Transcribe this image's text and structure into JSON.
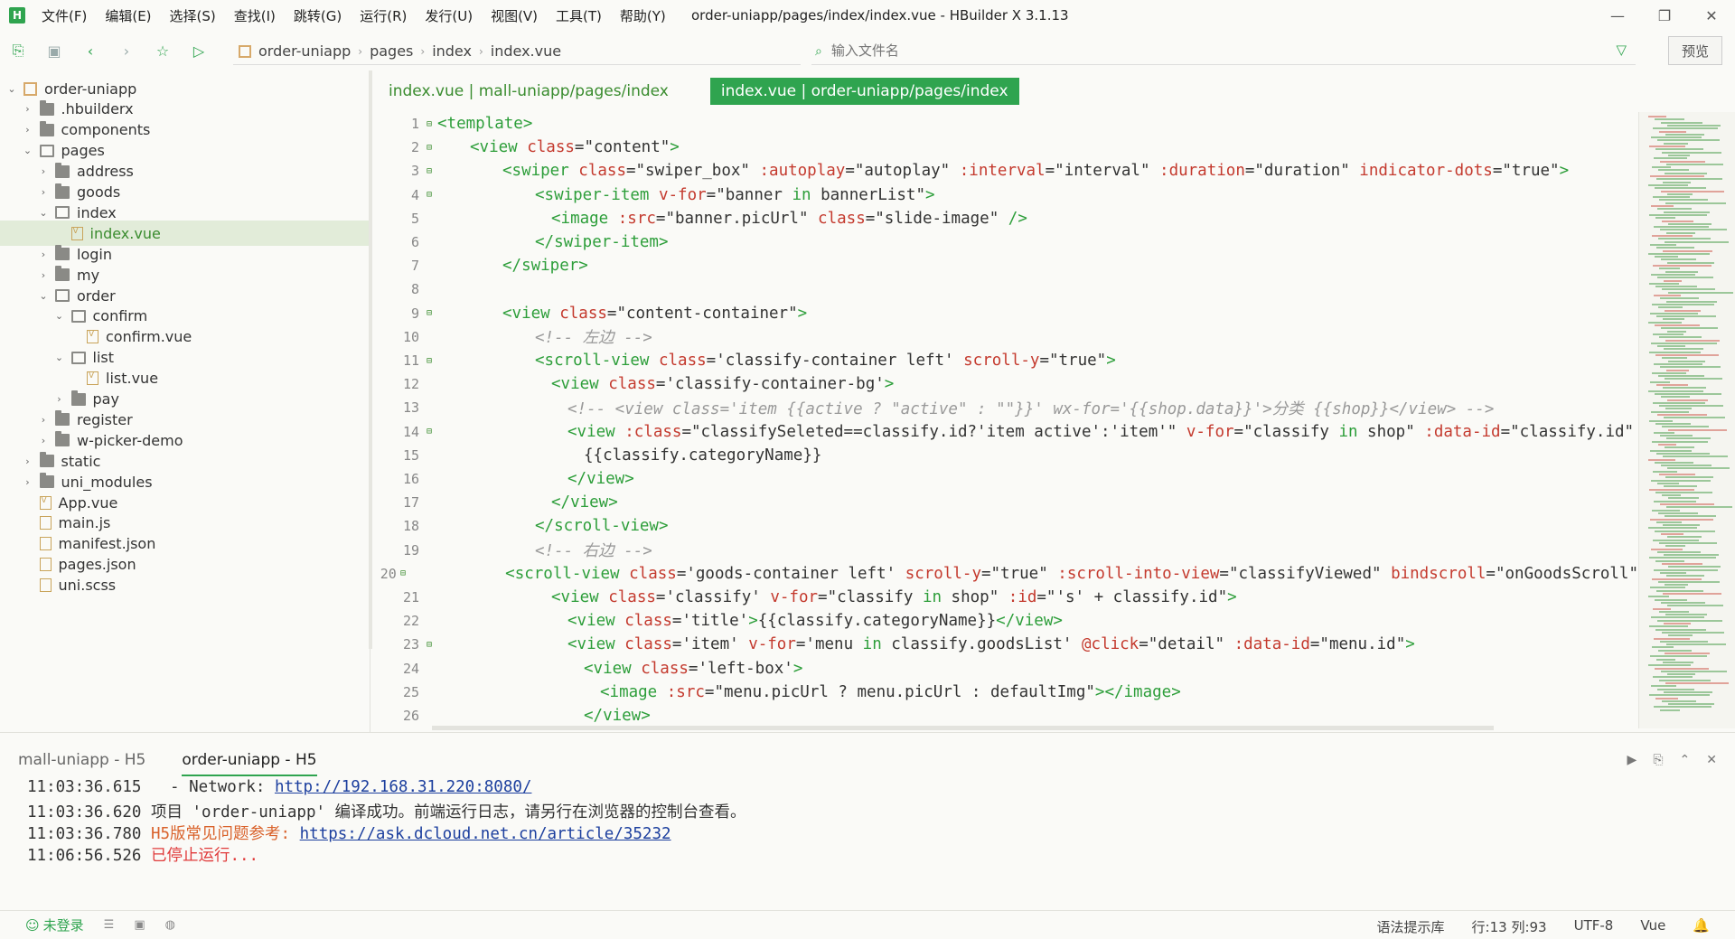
{
  "window": {
    "title": "order-uniapp/pages/index/index.vue - HBuilder X 3.1.13",
    "logo_text": "H",
    "controls": [
      "—",
      "❐",
      "✕"
    ]
  },
  "menu": [
    "文件(F)",
    "编辑(E)",
    "选择(S)",
    "查找(I)",
    "跳转(G)",
    "运行(R)",
    "发行(U)",
    "视图(V)",
    "工具(T)",
    "帮助(Y)"
  ],
  "toolbar": {
    "breadcrumb": [
      "order-uniapp",
      "pages",
      "index",
      "index.vue"
    ],
    "search_placeholder": "输入文件名",
    "preview_label": "预览"
  },
  "sidebar": {
    "items": [
      {
        "label": "order-uniapp",
        "depth": 0,
        "type": "project",
        "arrow": "⌄"
      },
      {
        "label": ".hbuilderx",
        "depth": 1,
        "type": "folder",
        "arrow": "›"
      },
      {
        "label": "components",
        "depth": 1,
        "type": "folder",
        "arrow": "›"
      },
      {
        "label": "pages",
        "depth": 1,
        "type": "folder-open",
        "arrow": "⌄"
      },
      {
        "label": "address",
        "depth": 2,
        "type": "folder",
        "arrow": "›"
      },
      {
        "label": "goods",
        "depth": 2,
        "type": "folder",
        "arrow": "›"
      },
      {
        "label": "index",
        "depth": 2,
        "type": "folder-open",
        "arrow": "⌄"
      },
      {
        "label": "index.vue",
        "depth": 3,
        "type": "vue",
        "arrow": "",
        "selected": true
      },
      {
        "label": "login",
        "depth": 2,
        "type": "folder",
        "arrow": "›"
      },
      {
        "label": "my",
        "depth": 2,
        "type": "folder",
        "arrow": "›"
      },
      {
        "label": "order",
        "depth": 2,
        "type": "folder-open",
        "arrow": "⌄"
      },
      {
        "label": "confirm",
        "depth": 3,
        "type": "folder-open",
        "arrow": "⌄"
      },
      {
        "label": "confirm.vue",
        "depth": 4,
        "type": "vue",
        "arrow": ""
      },
      {
        "label": "list",
        "depth": 3,
        "type": "folder-open",
        "arrow": "⌄"
      },
      {
        "label": "list.vue",
        "depth": 4,
        "type": "vue",
        "arrow": ""
      },
      {
        "label": "pay",
        "depth": 3,
        "type": "folder",
        "arrow": "›"
      },
      {
        "label": "register",
        "depth": 2,
        "type": "folder",
        "arrow": "›"
      },
      {
        "label": "w-picker-demo",
        "depth": 2,
        "type": "folder",
        "arrow": "›"
      },
      {
        "label": "static",
        "depth": 1,
        "type": "folder",
        "arrow": "›"
      },
      {
        "label": "uni_modules",
        "depth": 1,
        "type": "folder",
        "arrow": "›"
      },
      {
        "label": "App.vue",
        "depth": 1,
        "type": "vue",
        "arrow": ""
      },
      {
        "label": "main.js",
        "depth": 1,
        "type": "file",
        "arrow": ""
      },
      {
        "label": "manifest.json",
        "depth": 1,
        "type": "file",
        "arrow": ""
      },
      {
        "label": "pages.json",
        "depth": 1,
        "type": "file",
        "arrow": ""
      },
      {
        "label": "uni.scss",
        "depth": 1,
        "type": "file",
        "arrow": ""
      }
    ]
  },
  "editor": {
    "tabs": [
      {
        "label": "index.vue | mall-uniapp/pages/index",
        "active": false
      },
      {
        "label": "index.vue | order-uniapp/pages/index",
        "active": true
      }
    ],
    "lines": [
      {
        "n": "1",
        "fold": true,
        "indent": 0,
        "parts": [
          [
            "t-tag",
            "<template>"
          ]
        ]
      },
      {
        "n": "2",
        "fold": true,
        "indent": 2,
        "parts": [
          [
            "t-tag",
            "<view "
          ],
          [
            "t-attr",
            "class"
          ],
          [
            "t-str",
            "=\"content\""
          ],
          [
            "t-tag",
            ">"
          ]
        ]
      },
      {
        "n": "3",
        "fold": true,
        "indent": 4,
        "parts": [
          [
            "t-tag",
            "<swiper "
          ],
          [
            "t-attr",
            "class"
          ],
          [
            "t-str",
            "=\"swiper_box\" "
          ],
          [
            "t-attr",
            ":autoplay"
          ],
          [
            "t-str",
            "=\"autoplay\" "
          ],
          [
            "t-attr",
            ":interval"
          ],
          [
            "t-str",
            "=\"interval\" "
          ],
          [
            "t-attr",
            ":duration"
          ],
          [
            "t-str",
            "=\"duration\" "
          ],
          [
            "t-attr",
            "indicator-dots"
          ],
          [
            "t-str",
            "=\"true\""
          ],
          [
            "t-tag",
            ">"
          ]
        ]
      },
      {
        "n": "4",
        "fold": true,
        "indent": 6,
        "parts": [
          [
            "t-tag",
            "<swiper-item "
          ],
          [
            "t-attr",
            "v-for"
          ],
          [
            "t-str",
            "=\"banner "
          ],
          [
            "t-kw",
            "in"
          ],
          [
            "t-str",
            " bannerList\""
          ],
          [
            "t-tag",
            ">"
          ]
        ]
      },
      {
        "n": "5",
        "fold": false,
        "indent": 7,
        "parts": [
          [
            "t-tag",
            "<image "
          ],
          [
            "t-attr",
            ":src"
          ],
          [
            "t-str",
            "=\"banner.picUrl\" "
          ],
          [
            "t-attr",
            "class"
          ],
          [
            "t-str",
            "=\"slide-image\" "
          ],
          [
            "t-tag",
            "/>"
          ]
        ]
      },
      {
        "n": "6",
        "fold": false,
        "indent": 6,
        "parts": [
          [
            "t-tag",
            "</swiper-item>"
          ]
        ]
      },
      {
        "n": "7",
        "fold": false,
        "indent": 4,
        "parts": [
          [
            "t-tag",
            "</swiper>"
          ]
        ]
      },
      {
        "n": "8",
        "fold": false,
        "indent": 0,
        "parts": []
      },
      {
        "n": "9",
        "fold": true,
        "indent": 4,
        "parts": [
          [
            "t-tag",
            "<view "
          ],
          [
            "t-attr",
            "class"
          ],
          [
            "t-str",
            "=\"content-container\""
          ],
          [
            "t-tag",
            ">"
          ]
        ]
      },
      {
        "n": "10",
        "fold": false,
        "indent": 6,
        "parts": [
          [
            "t-cm",
            "<!-- 左边 -->"
          ]
        ]
      },
      {
        "n": "11",
        "fold": true,
        "indent": 6,
        "parts": [
          [
            "t-tag",
            "<scroll-view "
          ],
          [
            "t-attr",
            "class"
          ],
          [
            "t-str",
            "='classify-container left' "
          ],
          [
            "t-attr",
            "scroll-y"
          ],
          [
            "t-str",
            "=\"true\""
          ],
          [
            "t-tag",
            ">"
          ]
        ]
      },
      {
        "n": "12",
        "fold": false,
        "indent": 7,
        "parts": [
          [
            "t-tag",
            "<view "
          ],
          [
            "t-attr",
            "class"
          ],
          [
            "t-str",
            "='classify-container-bg'"
          ],
          [
            "t-tag",
            ">"
          ]
        ]
      },
      {
        "n": "13",
        "fold": false,
        "indent": 8,
        "parts": [
          [
            "t-cm",
            "<!-- <view class='item {{active ? \"active\" : \"\"}}' wx-for='{{shop.data}}'>分类 {{shop}}</view> -->"
          ]
        ]
      },
      {
        "n": "14",
        "fold": true,
        "indent": 8,
        "parts": [
          [
            "t-tag",
            "<view "
          ],
          [
            "t-attr",
            ":class"
          ],
          [
            "t-str",
            "=\"classifySeleted==classify.id?'item active':'item'\" "
          ],
          [
            "t-attr",
            "v-for"
          ],
          [
            "t-str",
            "=\"classify "
          ],
          [
            "t-kw",
            "in"
          ],
          [
            "t-str",
            " shop\" "
          ],
          [
            "t-attr",
            ":data-id"
          ],
          [
            "t-str",
            "=\"classify.id\""
          ]
        ]
      },
      {
        "n": "15",
        "fold": false,
        "indent": 9,
        "parts": [
          [
            "t-str",
            "{{classify.categoryName}}"
          ]
        ]
      },
      {
        "n": "16",
        "fold": false,
        "indent": 8,
        "parts": [
          [
            "t-tag",
            "</view>"
          ]
        ]
      },
      {
        "n": "17",
        "fold": false,
        "indent": 7,
        "parts": [
          [
            "t-tag",
            "</view>"
          ]
        ]
      },
      {
        "n": "18",
        "fold": false,
        "indent": 6,
        "parts": [
          [
            "t-tag",
            "</scroll-view>"
          ]
        ]
      },
      {
        "n": "19",
        "fold": false,
        "indent": 6,
        "parts": [
          [
            "t-cm",
            "<!-- 右边 -->"
          ]
        ]
      },
      {
        "n": "20",
        "fold": true,
        "indent": 6,
        "parts": [
          [
            "t-tag",
            "<scroll-view "
          ],
          [
            "t-attr",
            "class"
          ],
          [
            "t-str",
            "='goods-container left' "
          ],
          [
            "t-attr",
            "scroll-y"
          ],
          [
            "t-str",
            "=\"true\" "
          ],
          [
            "t-attr",
            ":scroll-into-view"
          ],
          [
            "t-str",
            "=\"classifyViewed\" "
          ],
          [
            "t-attr",
            "bindscroll"
          ],
          [
            "t-str",
            "=\"onGoodsScroll\""
          ]
        ]
      },
      {
        "n": "21",
        "fold": false,
        "indent": 7,
        "parts": [
          [
            "t-tag",
            "<view "
          ],
          [
            "t-attr",
            "class"
          ],
          [
            "t-str",
            "='classify' "
          ],
          [
            "t-attr",
            "v-for"
          ],
          [
            "t-str",
            "=\"classify "
          ],
          [
            "t-kw",
            "in"
          ],
          [
            "t-str",
            " shop\" "
          ],
          [
            "t-attr",
            ":id"
          ],
          [
            "t-str",
            "=\"'s' + classify.id\""
          ],
          [
            "t-tag",
            ">"
          ]
        ]
      },
      {
        "n": "22",
        "fold": false,
        "indent": 8,
        "parts": [
          [
            "t-tag",
            "<view "
          ],
          [
            "t-attr",
            "class"
          ],
          [
            "t-str",
            "='title'"
          ],
          [
            "t-tag",
            ">"
          ],
          [
            "t-str",
            "{{classify.categoryName}}"
          ],
          [
            "t-tag",
            "</view>"
          ]
        ]
      },
      {
        "n": "23",
        "fold": true,
        "indent": 8,
        "parts": [
          [
            "t-tag",
            "<view "
          ],
          [
            "t-attr",
            "class"
          ],
          [
            "t-str",
            "='item' "
          ],
          [
            "t-attr",
            "v-for"
          ],
          [
            "t-str",
            "='menu "
          ],
          [
            "t-kw",
            "in"
          ],
          [
            "t-str",
            " classify.goodsList' "
          ],
          [
            "t-attr",
            "@click"
          ],
          [
            "t-str",
            "=\"detail\" "
          ],
          [
            "t-attr",
            ":data-id"
          ],
          [
            "t-str",
            "=\"menu.id\""
          ],
          [
            "t-tag",
            ">"
          ]
        ]
      },
      {
        "n": "24",
        "fold": false,
        "indent": 9,
        "parts": [
          [
            "t-tag",
            "<view "
          ],
          [
            "t-attr",
            "class"
          ],
          [
            "t-str",
            "='left-box'"
          ],
          [
            "t-tag",
            ">"
          ]
        ]
      },
      {
        "n": "25",
        "fold": false,
        "indent": 10,
        "parts": [
          [
            "t-tag",
            "<image "
          ],
          [
            "t-attr",
            ":src"
          ],
          [
            "t-str",
            "=\"menu.picUrl ? menu.picUrl : defaultImg\""
          ],
          [
            "t-tag",
            "></image>"
          ]
        ]
      },
      {
        "n": "26",
        "fold": false,
        "indent": 9,
        "parts": [
          [
            "t-tag",
            "</view>"
          ]
        ]
      }
    ]
  },
  "console": {
    "tabs": [
      {
        "label": "mall-uniapp - H5",
        "active": false
      },
      {
        "label": "order-uniapp - H5",
        "active": true
      }
    ],
    "controls": [
      "▶",
      "⎘",
      "⌃",
      "✕"
    ],
    "logs": [
      {
        "time": "11:03:36.615",
        "parts": [
          [
            "",
            "   - Network: "
          ],
          [
            "link",
            "http://192.168.31.220:8080/"
          ]
        ]
      },
      {
        "time": "11:03:36.620",
        "parts": [
          [
            "",
            " 项目 'order-uniapp' 编译成功。前端运行日志，请另行在浏览器的控制台查看。"
          ]
        ]
      },
      {
        "time": "11:03:36.780",
        "parts": [
          [
            "orange",
            " H5版常见问题参考: "
          ],
          [
            "link",
            "https://ask.dcloud.net.cn/article/35232"
          ]
        ]
      },
      {
        "time": "11:06:56.526",
        "parts": [
          [
            "red",
            " 已停止运行..."
          ]
        ]
      }
    ]
  },
  "statusbar": {
    "login": "未登录",
    "syntax_lib": "语法提示库",
    "position": "行:13  列:93",
    "encoding": "UTF-8",
    "language": "Vue"
  }
}
